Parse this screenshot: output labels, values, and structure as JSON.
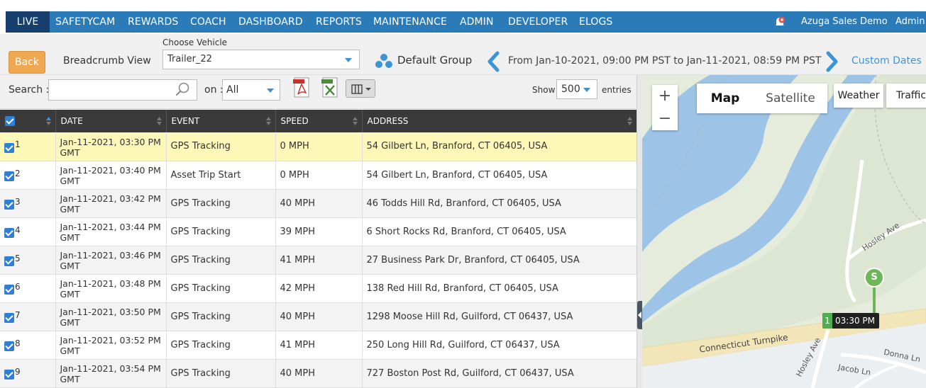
{
  "nav": {
    "items": [
      "LIVE",
      "SAFETYCAM",
      "REWARDS",
      "COACH",
      "DASHBOARD",
      "REPORTS",
      "MAINTENANCE",
      "ADMIN",
      "DEVELOPER",
      "ELOGS"
    ],
    "account": "Azuga Sales Demo",
    "user": "Admin",
    "active": "LIVE",
    "accent": "#2b7bb9"
  },
  "toolbar": {
    "back_label": "Back",
    "breadcrumb_label": "Breadcrumb View",
    "choose_vehicle_label": "Choose Vehicle",
    "vehicle": "Trailer_22",
    "group": "Default Group",
    "date_range": "From Jan-10-2021, 09:00 PM PST to Jan-11-2021, 08:59 PM PST",
    "custom_dates": "Custom Dates"
  },
  "table_controls": {
    "search_label": "Search :",
    "on_label": "on :",
    "on_value": "All",
    "show_label": "Show",
    "show_value": "500",
    "entries_label": "entries"
  },
  "table": {
    "columns": [
      "DATE",
      "EVENT",
      "SPEED",
      "ADDRESS"
    ],
    "rows": [
      {
        "num": "1",
        "date": "Jan-11-2021, 03:30 PM GMT",
        "event": "GPS Tracking",
        "speed": "0 MPH",
        "address": "54 Gilbert Ln, Branford, CT 06405, USA"
      },
      {
        "num": "2",
        "date": "Jan-11-2021, 03:40 PM GMT",
        "event": "Asset Trip Start",
        "speed": "0 MPH",
        "address": "54 Gilbert Ln, Branford, CT 06405, USA"
      },
      {
        "num": "3",
        "date": "Jan-11-2021, 03:42 PM GMT",
        "event": "GPS Tracking",
        "speed": "40 MPH",
        "address": "46 Todds Hill Rd, Branford, CT 06405, USA"
      },
      {
        "num": "4",
        "date": "Jan-11-2021, 03:44 PM GMT",
        "event": "GPS Tracking",
        "speed": "39 MPH",
        "address": "6 Short Rocks Rd, Branford, CT 06405, USA"
      },
      {
        "num": "5",
        "date": "Jan-11-2021, 03:46 PM GMT",
        "event": "GPS Tracking",
        "speed": "41 MPH",
        "address": "27 Business Park Dr, Branford, CT 06405, USA"
      },
      {
        "num": "6",
        "date": "Jan-11-2021, 03:48 PM GMT",
        "event": "GPS Tracking",
        "speed": "42 MPH",
        "address": "138 Red Hill Rd, Branford, CT 06405, USA"
      },
      {
        "num": "7",
        "date": "Jan-11-2021, 03:50 PM GMT",
        "event": "GPS Tracking",
        "speed": "40 MPH",
        "address": "1298 Moose Hill Rd, Guilford, CT 06437, USA"
      },
      {
        "num": "8",
        "date": "Jan-11-2021, 03:52 PM GMT",
        "event": "GPS Tracking",
        "speed": "41 MPH",
        "address": "250 Long Hill Rd, Guilford, CT 06437, USA"
      },
      {
        "num": "9",
        "date": "Jan-11-2021, 03:54 PM GMT",
        "event": "GPS Tracking",
        "speed": "40 MPH",
        "address": "727 Boston Post Rd, Guilford, CT 06437, USA"
      }
    ]
  },
  "map": {
    "zoom_in": "+",
    "zoom_out": "−",
    "tab_map": "Map",
    "tab_satellite": "Satellite",
    "weather": "Weather",
    "traffic": "Traffic",
    "marker_letter": "S",
    "marker_num": "1",
    "marker_time": "03:30 PM",
    "labels": {
      "turnpike": "Connecticut Turnpike",
      "hosley_ave": "Hosley Ave",
      "hosley_ave2": "Hosley Ave",
      "donna_ln": "Donna Ln",
      "jacob_ln": "Jacob Ln"
    }
  }
}
